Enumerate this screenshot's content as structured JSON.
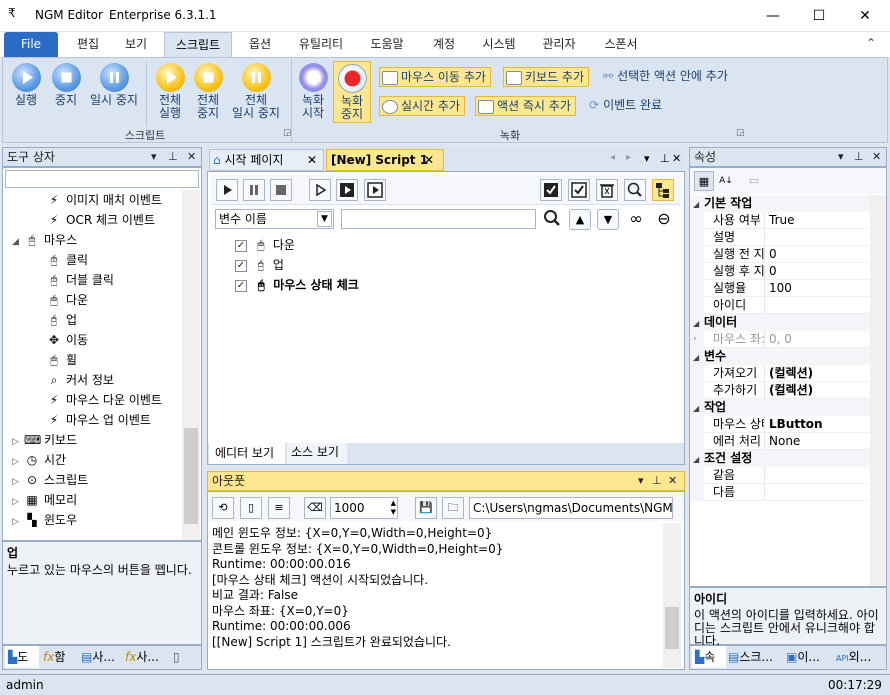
{
  "window": {
    "title_app": "NGM Editor",
    "title_version": "Enterprise 6.3.1.1",
    "menu_glyph": "₹",
    "min": "—",
    "max": "☐",
    "close": "✕",
    "collapse": "⌃"
  },
  "ribbon_tabs": [
    "File",
    "편집",
    "보기",
    "스크립트",
    "옵션",
    "유틸리티",
    "도움말",
    "계정",
    "시스템",
    "관리자",
    "스폰서"
  ],
  "ribbon": {
    "run": "실행",
    "stop": "중지",
    "pause": "일시 중지",
    "run_all_1": "전체",
    "run_all_2": "실행",
    "stop_all_1": "전체",
    "stop_all_2": "중지",
    "pause_all_1": "전체",
    "pause_all_2": "일시 중지",
    "script_group": "스크립트",
    "rec_start_1": "녹화",
    "rec_start_2": "시작",
    "rec_stop_1": "녹화",
    "rec_stop_2": "중지",
    "mouse_move_add": "마우스 이동 추가",
    "keyboard_add": "키보드 추가",
    "add_in_selected": "선택한 액션 안에 추가",
    "realtime_add": "실시간 추가",
    "action_now_add": "액션 즉시 추가",
    "event_done": "이벤트 완료",
    "record_group": "녹화"
  },
  "toolbox": {
    "title": "도구 상자",
    "items": [
      {
        "label": "이미지 매치 이벤트",
        "icon": "bolt-icon",
        "glyph": "⚡"
      },
      {
        "label": "OCR 체크 이벤트",
        "icon": "bolt-icon",
        "glyph": "⚡"
      },
      {
        "label": "마우스",
        "icon": "mouse-click-icon",
        "glyph": "🖰"
      },
      {
        "label": "클릭",
        "icon": "click-icon",
        "glyph": "🖰"
      },
      {
        "label": "더블 클릭",
        "icon": "double-click-icon",
        "glyph": "🖰"
      },
      {
        "label": "다운",
        "icon": "mouse-down-icon",
        "glyph": "🖱"
      },
      {
        "label": "업",
        "icon": "mouse-up-icon",
        "glyph": "🖯"
      },
      {
        "label": "이동",
        "icon": "move-icon",
        "glyph": "✥"
      },
      {
        "label": "휠",
        "icon": "mouse-wheel-icon",
        "glyph": "🖱"
      },
      {
        "label": "커서 정보",
        "icon": "cursor-info-icon",
        "glyph": "⌕"
      },
      {
        "label": "마우스 다운 이벤트",
        "icon": "bolt-icon",
        "glyph": "⚡"
      },
      {
        "label": "마우스 업 이벤트",
        "icon": "bolt-icon",
        "glyph": "⚡"
      },
      {
        "label": "키보드",
        "icon": "keyboard-icon",
        "glyph": "⌨"
      },
      {
        "label": "시간",
        "icon": "clock-icon",
        "glyph": "◷"
      },
      {
        "label": "스크립트",
        "icon": "script-icon",
        "glyph": "⊙"
      },
      {
        "label": "메모리",
        "icon": "memory-icon",
        "glyph": "▦"
      },
      {
        "label": "윈도우",
        "icon": "windows-icon",
        "glyph": "▚"
      }
    ],
    "desc_title": "업",
    "desc_text": "누르고 있는 마우스의 버튼을 뗍니다.",
    "bottom_tabs": [
      "도",
      "함",
      "사...",
      "사...",
      "..."
    ]
  },
  "editor": {
    "tab_start": "시작 페이지",
    "tab_script": "[New] Script 1",
    "var_select": "변수 이름",
    "actions": [
      "다운",
      "업",
      "마우스 상태 체크"
    ],
    "view_editor": "에디터 보기",
    "view_source": "소스 보기"
  },
  "output": {
    "title": "아웃풋",
    "count": "1000",
    "path": "C:\\Users\\ngmas\\Documents\\NGM6\\",
    "lines": [
      "메인 윈도우 정보: {X=0,Y=0,Width=0,Height=0}",
      "콘트롤 윈도우 정보: {X=0,Y=0,Width=0,Height=0}",
      "Runtime: 00:00:00.016",
      "[마우스 상태 체크] 액션이 시작되었습니다.",
      "비교 결과: False",
      "마우스 좌표: {X=0,Y=0}",
      "Runtime: 00:00:00.006",
      "[[New] Script 1] 스크립트가 완료되었습니다."
    ]
  },
  "properties": {
    "title": "속성",
    "rows": [
      {
        "type": "cat",
        "label": "기본 작업"
      },
      {
        "type": "prop",
        "label": "사용 여부",
        "value": "True"
      },
      {
        "type": "prop",
        "label": "설명",
        "value": ""
      },
      {
        "type": "prop",
        "label": "실행 전 지",
        "value": "0"
      },
      {
        "type": "prop",
        "label": "실행 후 지",
        "value": "0"
      },
      {
        "type": "prop",
        "label": "실행율",
        "value": "100"
      },
      {
        "type": "prop",
        "label": "아이디",
        "value": ""
      },
      {
        "type": "cat",
        "label": "데이터"
      },
      {
        "type": "prop",
        "label": "마우스 좌:",
        "value": "0, 0",
        "gray": true
      },
      {
        "type": "cat",
        "label": "변수"
      },
      {
        "type": "prop",
        "label": "가져오기",
        "value": "(컬렉션)",
        "bold": true
      },
      {
        "type": "prop",
        "label": "추가하기",
        "value": "(컬렉션)",
        "bold": true
      },
      {
        "type": "cat",
        "label": "작업"
      },
      {
        "type": "prop",
        "label": "마우스 상태",
        "value": "LButton",
        "bold": true
      },
      {
        "type": "prop",
        "label": "에러 처리",
        "value": "None"
      },
      {
        "type": "cat",
        "label": "조건 설정"
      },
      {
        "type": "prop",
        "label": "같음",
        "value": ""
      },
      {
        "type": "prop",
        "label": "다름",
        "value": ""
      }
    ],
    "desc_title": "아이디",
    "desc_text": "이 액션의 아이디를 입력하세요. 아이디는 스크립트 안에서 유니크해야 합니다.",
    "bottom_tabs": [
      "속",
      "스크...",
      "이...",
      "외..."
    ]
  },
  "status": {
    "user": "admin",
    "time": "00:17:29"
  }
}
